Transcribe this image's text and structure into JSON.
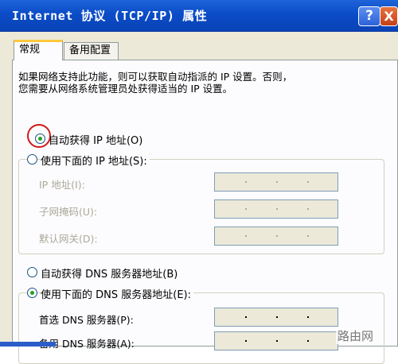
{
  "window": {
    "title": "Internet 协议 (TCP/IP) 属性",
    "help_label": "?",
    "close_label": "X"
  },
  "tabs": [
    {
      "label": "常规",
      "active": true
    },
    {
      "label": "备用配置",
      "active": false
    }
  ],
  "description": "如果网络支持此功能，则可以获取自动指派的 IP 设置。否则，\n您需要从网络系统管理员处获得适当的 IP 设置。",
  "ip_section": {
    "auto_option": "自动获得 IP 地址(O)",
    "manual_option": "使用下面的 IP 地址(S):",
    "fields": [
      {
        "label": "IP 地址(I):",
        "value": ""
      },
      {
        "label": "子网掩码(U):",
        "value": ""
      },
      {
        "label": "默认网关(D):",
        "value": ""
      }
    ]
  },
  "dns_section": {
    "auto_option": "自动获得 DNS 服务器地址(B)",
    "manual_option": "使用下面的 DNS 服务器地址(E):",
    "fields": [
      {
        "label": "首选 DNS 服务器(P):",
        "value": ""
      },
      {
        "label": "备用 DNS 服务器(A):",
        "value": ""
      }
    ]
  },
  "watermark": "路由网",
  "colors": {
    "titlebar": "#0b4cc7",
    "dialog_bg": "#ece9d8",
    "tab_highlight": "#ffc83c",
    "highlight_ring": "#d01818",
    "radio_checked": "#21a121"
  }
}
